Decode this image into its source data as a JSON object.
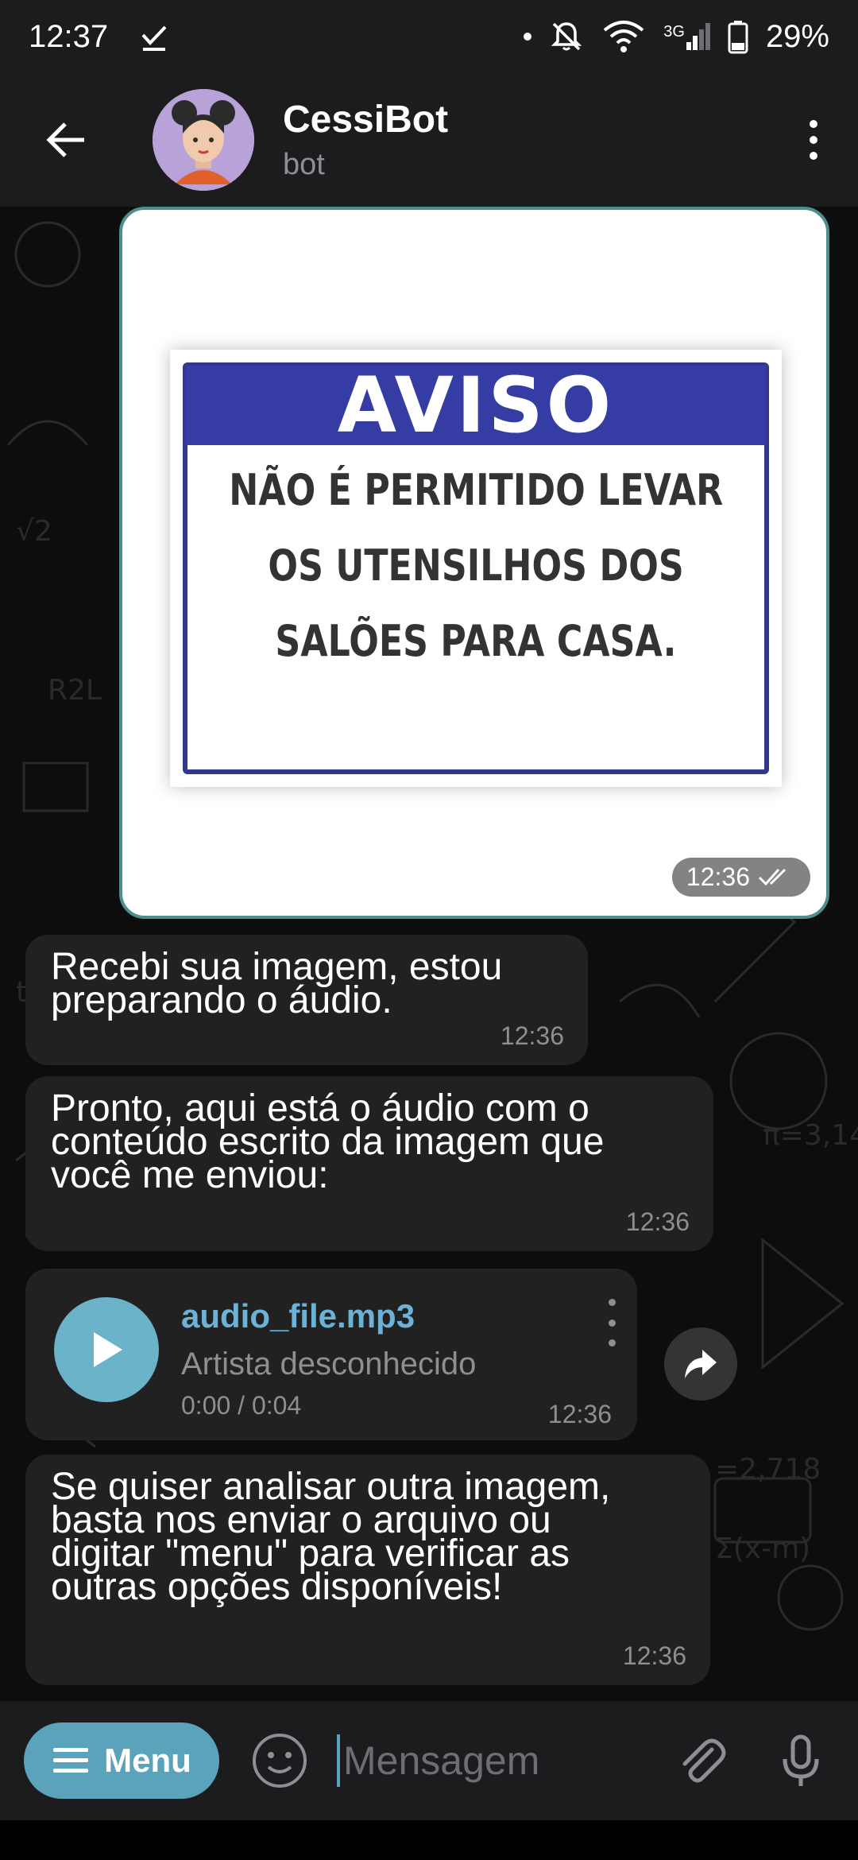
{
  "status_bar": {
    "time": "12:37",
    "network_label": "3G",
    "battery": "29%"
  },
  "header": {
    "title": "CessiBot",
    "subtitle": "bot"
  },
  "messages": {
    "image": {
      "sign_title": "AVISO",
      "sign_lines": [
        "NÃO É PERMITIDO LEVAR",
        "OS UTENSILHOS DOS",
        "SALÕES PARA CASA."
      ],
      "time": "12:36"
    },
    "bubble1": {
      "text": "Recebi sua imagem, estou\npreparando o áudio.",
      "time": "12:36"
    },
    "bubble2": {
      "text": "Pronto, aqui está o áudio com o\nconteúdo escrito da imagem que\nvocê me enviou:",
      "time": "12:36"
    },
    "audio": {
      "file_name": "audio_file.mp3",
      "artist": "Artista desconhecido",
      "duration": "0:00 / 0:04",
      "time": "12:36"
    },
    "bubble3": {
      "text": "Se quiser analisar outra imagem,\nbasta nos enviar o arquivo ou\ndigitar \"menu\" para verificar as\noutras opções disponíveis!",
      "time": "12:36"
    }
  },
  "input_bar": {
    "menu_label": "Menu",
    "placeholder": "Mensagem"
  },
  "colors": {
    "accent": "#5ba3bb",
    "bubble": "#212121",
    "header": "#1c1c1e",
    "sign_blue": "#353ca4"
  }
}
